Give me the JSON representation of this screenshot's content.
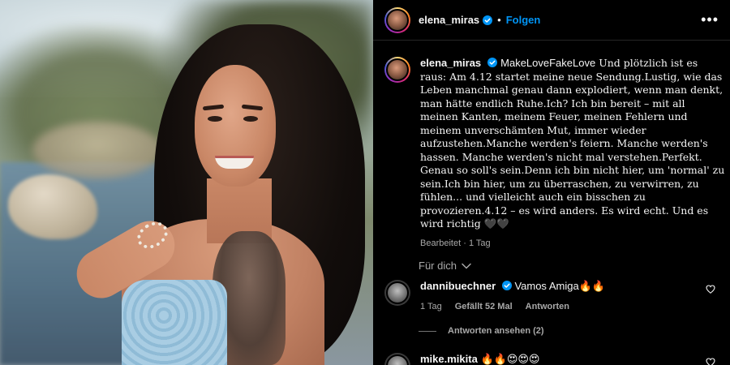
{
  "post": {
    "username": "elena_miras",
    "follow_label": "Folgen",
    "separator": "•",
    "more_label": "•••"
  },
  "caption": {
    "username": "elena_miras",
    "hashtag": "MakeLoveFakeLove",
    "text": "Und plötzlich ist es raus: Am 4.12 startet meine neue Sendung.Lustig, wie das Leben manchmal genau dann explodiert, wenn man denkt, man hätte endlich Ruhe.Ich? Ich bin bereit – mit all meinen Kanten, meinem Feuer, meinen Fehlern und meinem unverschämten Mut, immer wieder aufzustehen.Manche werden's feiern. Manche werden's hassen. Manche werden's nicht mal verstehen.Perfekt. Genau so soll's sein.Denn ich bin nicht hier, um 'normal' zu sein.Ich bin hier, um zu überraschen, zu verwirren, zu fühlen... und vielleicht auch ein bisschen zu provozieren.4.12 – es wird anders. Es wird echt. Und es wird richtig 🖤🖤",
    "edited_label": "Bearbeitet",
    "time": "1 Tag"
  },
  "filter_label": "Für dich",
  "comments": [
    {
      "username": "dannibuechner",
      "text": "Vamos Amiga🔥🔥",
      "time": "1 Tag",
      "likes_label": "Gefällt 52 Mal",
      "reply_label": "Antworten",
      "view_replies": "Antworten ansehen (2)"
    },
    {
      "username": "mike.mikita",
      "text": "🔥🔥😍😍😍"
    }
  ],
  "colors": {
    "background": "#000000",
    "text": "#f5f5f5",
    "secondary": "#a8a8a8",
    "link": "#0095f6"
  },
  "icons": [
    "verified-badge-icon",
    "more-options-icon",
    "chevron-down-icon",
    "heart-icon"
  ]
}
